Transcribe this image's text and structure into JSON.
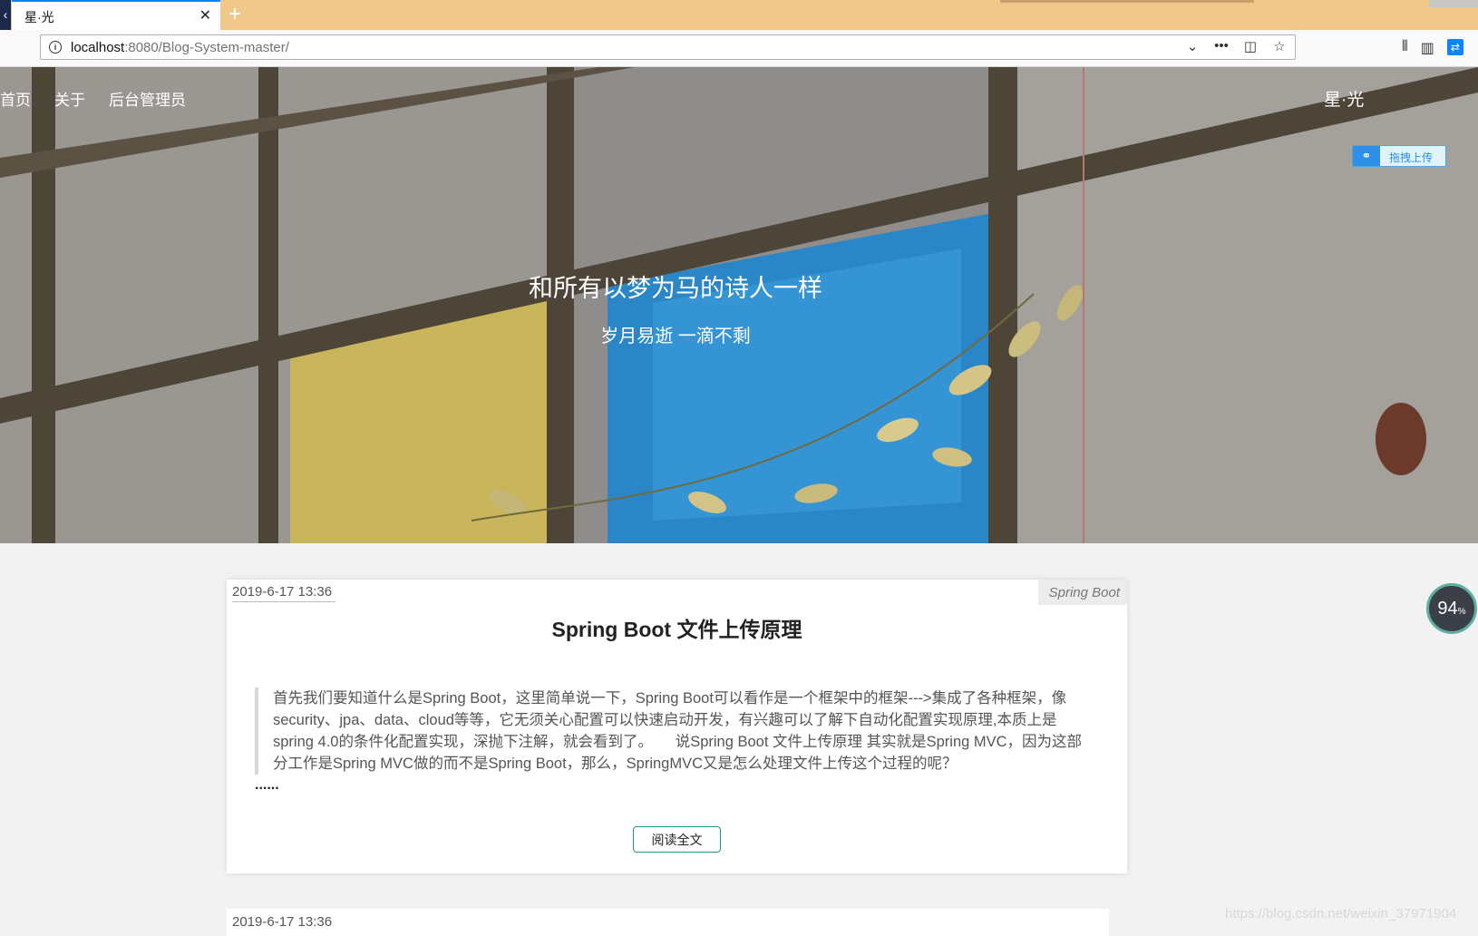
{
  "browser": {
    "tab_title": "星·光",
    "tab_close": "✕",
    "new_tab": "+",
    "url_host": "localhost",
    "url_rest": ":8080/Blog-System-master/",
    "icons": [
      "info-icon",
      "chevron-down-icon",
      "more-icon",
      "pocket-icon",
      "star-icon",
      "library-icon",
      "sidebar-icon",
      "sync-icon"
    ]
  },
  "site": {
    "nav": [
      "首页",
      "关于",
      "后台管理员"
    ],
    "brand": "星·光",
    "upload_label": "拖拽上传",
    "hero_title": "和所有以梦为马的诗人一样",
    "hero_subtitle": "岁月易逝 一滴不剩"
  },
  "posts": [
    {
      "date": "2019-6-17 13:36",
      "category": "Spring Boot",
      "title": "Spring Boot 文件上传原理",
      "summary": "首先我们要知道什么是Spring Boot，这里简单说一下，Spring Boot可以看作是一个框架中的框架--->集成了各种框架，像security、jpa、data、cloud等等，它无须关心配置可以快速启动开发，有兴趣可以了解下自动化配置实现原理,本质上是spring 4.0的条件化配置实现，深抛下注解，就会看到了。　　说Spring Boot 文件上传原理 其实就是Spring MVC，因为这部分工作是Spring MVC做的而不是Spring Boot，那么，SpringMVC又是怎么处理文件上传这个过程的呢？",
      "ellipsis": "......",
      "read_more": "阅读全文"
    },
    {
      "date": "2019-6-17 13:36"
    }
  ],
  "widgets": {
    "speed_value": "94",
    "speed_unit": "%",
    "watermark": "https://blog.csdn.net/weixin_37971904"
  },
  "colors": {
    "tabbar": "#f0c98a",
    "accent_blue": "#0a84ff",
    "read_more_border": "#1a9a8f",
    "upload_blue": "#2d8fe6"
  }
}
